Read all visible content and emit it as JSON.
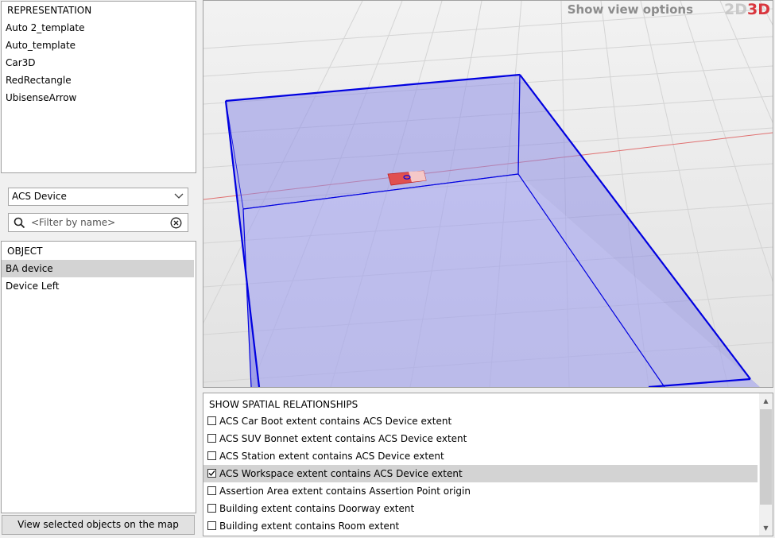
{
  "representation": {
    "header": "REPRESENTATION",
    "items": [
      "Auto 2_template",
      "Auto_template",
      "Car3D",
      "RedRectangle",
      "UbisenseArrow"
    ]
  },
  "type_select": {
    "value": "ACS Device"
  },
  "filter": {
    "placeholder": "<Filter by name>"
  },
  "objects": {
    "header": "OBJECT",
    "items": [
      "BA device",
      "Device Left"
    ],
    "selected_index": 0
  },
  "view_button": {
    "label": "View selected objects on the map"
  },
  "viewport": {
    "options_label": "Show view options",
    "mode_2d": "2D",
    "mode_3d": "3D",
    "active_mode": "3D"
  },
  "spatial": {
    "header": "SHOW SPATIAL RELATIONSHIPS",
    "items": [
      {
        "label": "ACS Car Boot extent contains ACS Device extent",
        "checked": false
      },
      {
        "label": "ACS SUV Bonnet extent contains ACS Device extent",
        "checked": false
      },
      {
        "label": "ACS Station extent contains ACS Device extent",
        "checked": false
      },
      {
        "label": "ACS Workspace extent contains ACS Device extent",
        "checked": true
      },
      {
        "label": "Assertion Area extent contains Assertion Point origin",
        "checked": false
      },
      {
        "label": "Building extent contains Doorway extent",
        "checked": false
      },
      {
        "label": "Building extent contains Room extent",
        "checked": false
      }
    ]
  },
  "colors": {
    "box_fill": "#8f8fe8",
    "box_edge": "#0000e0",
    "accent_3d": "#d9363e",
    "selection": "#d3d3d3"
  },
  "icons": {
    "search": "search-icon",
    "clear": "clear-circle-x-icon",
    "dropdown": "chevron-down-icon"
  }
}
